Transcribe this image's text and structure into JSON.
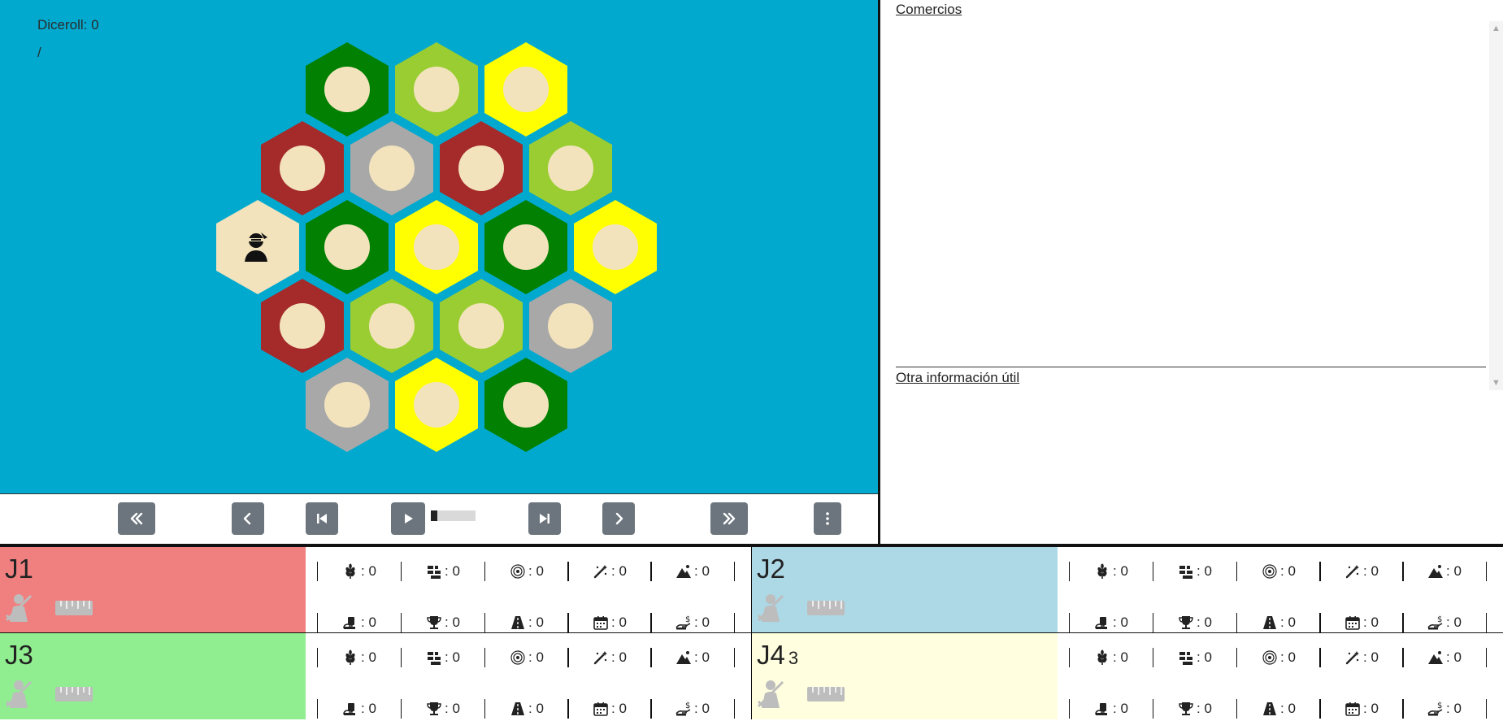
{
  "board": {
    "diceroll_label": "Diceroll: 0",
    "sub_label": "/",
    "tiles": [
      {
        "type": "forest",
        "color": "#028002"
      },
      {
        "type": "pasture",
        "color": "#9acd32"
      },
      {
        "type": "fields",
        "color": "#ffff01"
      },
      {
        "type": "hills",
        "color": "#a52a2a"
      },
      {
        "type": "mountains",
        "color": "#a8a8a8"
      },
      {
        "type": "hills",
        "color": "#a52a2a"
      },
      {
        "type": "pasture",
        "color": "#9acd32"
      },
      {
        "type": "desert",
        "color": "#f2e3bd",
        "robber": true
      },
      {
        "type": "forest",
        "color": "#028002"
      },
      {
        "type": "fields",
        "color": "#ffff01"
      },
      {
        "type": "forest",
        "color": "#028002"
      },
      {
        "type": "fields",
        "color": "#ffff01"
      },
      {
        "type": "hills",
        "color": "#a52a2a"
      },
      {
        "type": "pasture",
        "color": "#9acd32"
      },
      {
        "type": "pasture",
        "color": "#9acd32"
      },
      {
        "type": "mountains",
        "color": "#a8a8a8"
      },
      {
        "type": "mountains",
        "color": "#a8a8a8"
      },
      {
        "type": "fields",
        "color": "#ffff01"
      },
      {
        "type": "forest",
        "color": "#028002"
      }
    ]
  },
  "controls": {
    "progress": 0.15,
    "buttons": [
      "rewind-button",
      "prev-button",
      "skip-start-button",
      "play-button",
      "skip-end-button",
      "next-button",
      "fast-forward-button",
      "more-options-button"
    ]
  },
  "side": {
    "trades_title": "Comercios",
    "info_title": "Otra información útil"
  },
  "stat_icons": [
    "wheat-icon",
    "brick-icon",
    "wool-icon",
    "wand-icon",
    "mountain-icon",
    "hand-card-icon",
    "trophy-icon",
    "road-icon",
    "calendar-icon",
    "hand-coin-icon"
  ],
  "players": [
    {
      "name": "J1",
      "points": "",
      "color": "#f08080",
      "stats": [
        ": 0",
        ": 0",
        ": 0",
        ": 0",
        ": 0",
        ": 0",
        ": 0",
        ": 0",
        ": 0",
        ": 0"
      ]
    },
    {
      "name": "J2",
      "points": "",
      "color": "#add8e6",
      "stats": [
        ": 0",
        ": 0",
        ": 0",
        ": 0",
        ": 0",
        ": 0",
        ": 0",
        ": 0",
        ": 0",
        ": 0"
      ]
    },
    {
      "name": "J3",
      "points": "",
      "color": "#90ee90",
      "stats": [
        ": 0",
        ": 0",
        ": 0",
        ": 0",
        ": 0",
        ": 0",
        ": 0",
        ": 0",
        ": 0",
        ": 0"
      ]
    },
    {
      "name": "J4",
      "points": "3",
      "color": "#ffffe0",
      "stats": [
        ": 0",
        ": 0",
        ": 0",
        ": 0",
        ": 0",
        ": 0",
        ": 0",
        ": 0",
        ": 0",
        ": 0"
      ]
    }
  ]
}
